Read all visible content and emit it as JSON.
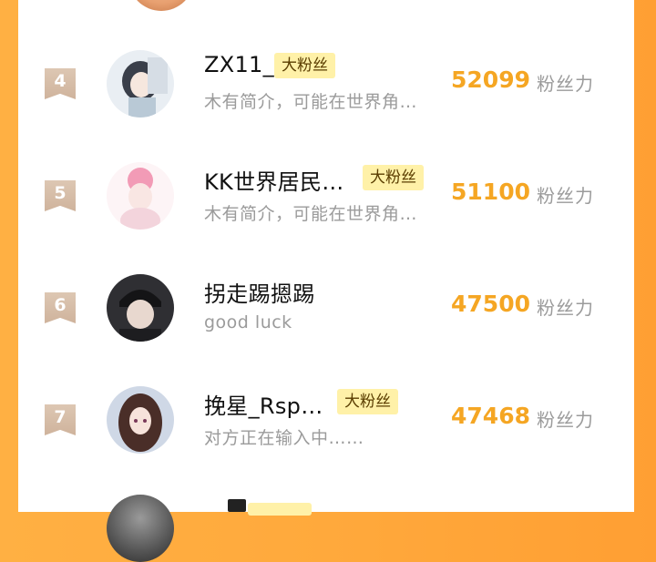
{
  "score_unit": "粉丝力",
  "rows": [
    {
      "rank": "4",
      "name": "ZX11_",
      "badge": "大粉丝",
      "bio": "木有简介，可能在世界角…",
      "score": "52099",
      "avatar_icon": "avatar-anime-girl-gray-hair"
    },
    {
      "rank": "5",
      "name": "KK世界居民…",
      "badge": "大粉丝",
      "bio": "木有简介，可能在世界角…",
      "score": "51100",
      "avatar_icon": "avatar-anime-girl-pink-hair"
    },
    {
      "rank": "6",
      "name": "拐走踢摁踢",
      "badge": "",
      "bio": "good luck",
      "score": "47500",
      "avatar_icon": "avatar-person-black-cap"
    },
    {
      "rank": "7",
      "name": "挽星_Rsp…",
      "badge": "大粉丝",
      "bio": "对方正在输入中……",
      "score": "47468",
      "avatar_icon": "avatar-anime-girl-brown-hair"
    }
  ],
  "colors": {
    "accent": "#f5a623",
    "badge_bg": "#fff1a8",
    "rank_bg": "#d8bfa9",
    "frame": "#ffa93c"
  }
}
